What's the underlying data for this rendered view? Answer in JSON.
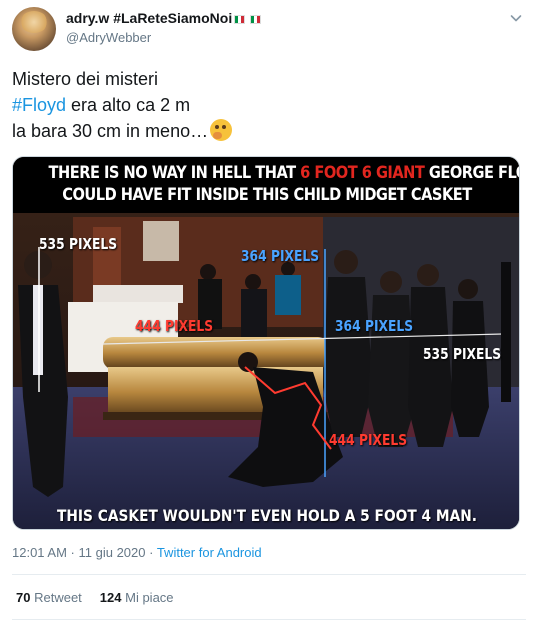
{
  "author": {
    "display_name": "adry.w #LaReteSiamoNoi",
    "handle": "@AdryWebber"
  },
  "tweet": {
    "line1": "Mistero dei misteri",
    "hashtag": "#Floyd",
    "line2_rest": " era alto ca 2 m",
    "line3": "la bara 30 cm in meno…"
  },
  "media": {
    "banner_line1_a": "THERE IS NO WAY IN HELL THAT ",
    "banner_line1_red": "6 FOOT 6 GIANT",
    "banner_line1_b": " GEORGE FLOYD",
    "banner_line2": "COULD HAVE FIT INSIDE THIS CHILD MIDGET CASKET",
    "labels": {
      "left_535": "535 PIXELS",
      "top_364": "364 PIXELS",
      "casket_444": "444 PIXELS",
      "mid_364": "364 PIXELS",
      "right_535": "535 PIXELS",
      "bottom_444": "444 PIXELS"
    },
    "bottom_caption": "THIS CASKET WOULDN'T EVEN HOLD A 5 FOOT 4 MAN."
  },
  "meta": {
    "time": "12:01 AM",
    "separator": " · ",
    "date": "11 giu 2020",
    "source": "Twitter for Android"
  },
  "stats": {
    "retweets_count": "70",
    "retweets_label": "Retweet",
    "likes_count": "124",
    "likes_label": "Mi piace"
  },
  "colors": {
    "link": "#1b95e0",
    "muted": "#657786",
    "label_blue": "#4aa3ff",
    "label_red": "#ff3b30"
  }
}
